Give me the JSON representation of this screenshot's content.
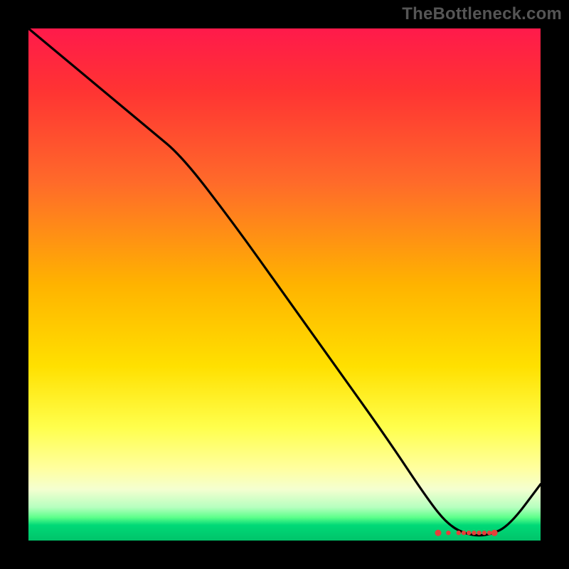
{
  "watermark": "TheBottleneck.com",
  "chart_data": {
    "type": "line",
    "title": "",
    "xlabel": "",
    "ylabel": "",
    "xlim": [
      0,
      100
    ],
    "ylim": [
      0,
      100
    ],
    "description": "Bottleneck curve over a vertical red-to-green gradient; x is an unlabeled configuration axis, y is bottleneck percentage (100 at top, 0 at bottom). Curve descends from top-left, flattens near zero around x≈80–90, then rises slightly.",
    "series": [
      {
        "name": "bottleneck-curve",
        "x": [
          0,
          12,
          24,
          30,
          40,
          50,
          60,
          70,
          78,
          82,
          86,
          90,
          94,
          100
        ],
        "y": [
          100,
          90,
          80,
          75,
          62,
          48,
          34,
          20,
          8,
          3,
          1,
          1,
          3,
          11
        ]
      }
    ],
    "optimal_band": {
      "name": "optimal-zone-markers",
      "x_points": [
        80,
        82,
        84,
        85,
        86,
        87,
        88,
        89,
        90,
        91
      ],
      "y_value": 1.5
    },
    "gradient_stops": [
      {
        "pos": 0.0,
        "color": "#ff1a4b"
      },
      {
        "pos": 0.12,
        "color": "#ff3333"
      },
      {
        "pos": 0.3,
        "color": "#ff6a2a"
      },
      {
        "pos": 0.5,
        "color": "#ffb300"
      },
      {
        "pos": 0.66,
        "color": "#ffe000"
      },
      {
        "pos": 0.78,
        "color": "#ffff4d"
      },
      {
        "pos": 0.86,
        "color": "#ffffa0"
      },
      {
        "pos": 0.9,
        "color": "#f4ffd0"
      },
      {
        "pos": 0.935,
        "color": "#b6ffbf"
      },
      {
        "pos": 0.955,
        "color": "#5cff8a"
      },
      {
        "pos": 0.97,
        "color": "#00d977"
      },
      {
        "pos": 1.0,
        "color": "#00c46a"
      }
    ]
  }
}
